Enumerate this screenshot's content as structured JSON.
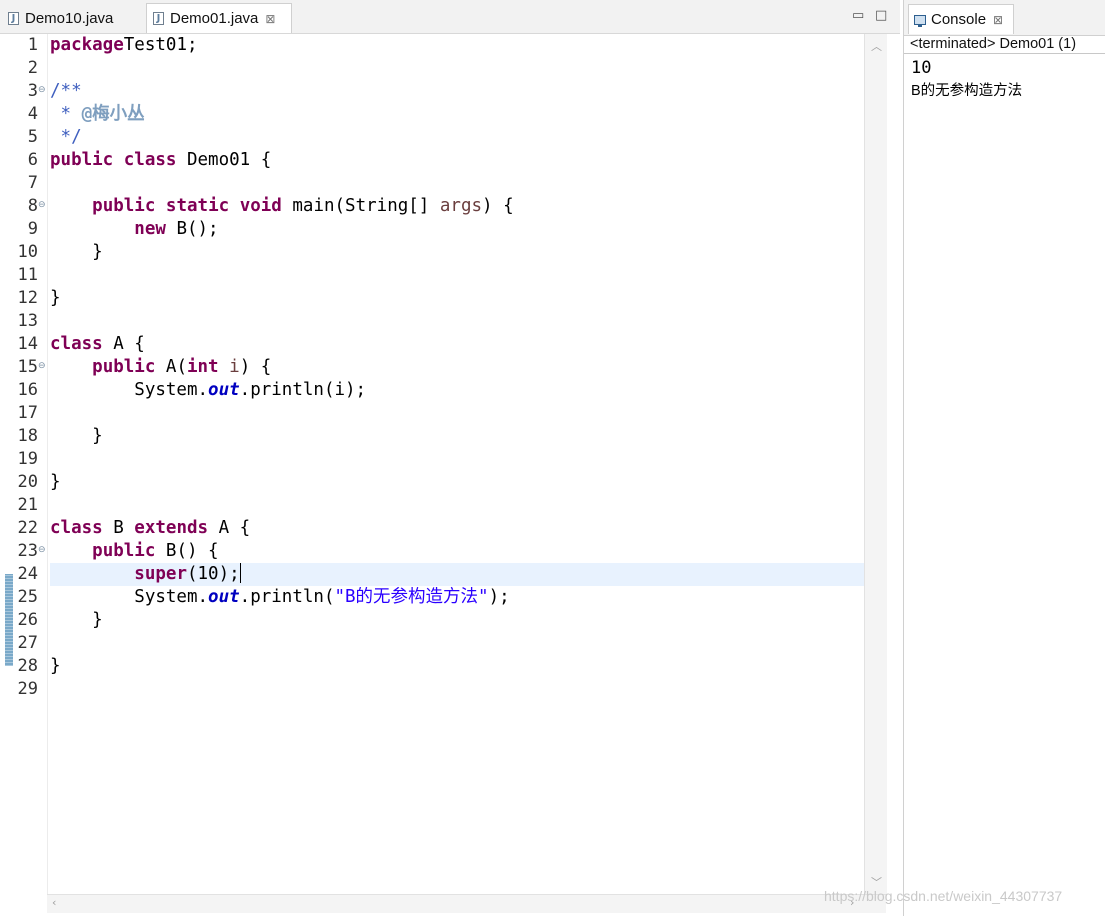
{
  "editor": {
    "tabs": [
      {
        "label": "Demo10.java",
        "active": false
      },
      {
        "label": "Demo01.java",
        "active": true
      }
    ],
    "close_glyph": "⊠",
    "minimize_glyph": "▭",
    "maximize_glyph": "□",
    "current_line": 24,
    "lines": [
      {
        "n": "1",
        "tokens": [
          [
            "kw",
            "package"
          ],
          [
            "",
            "Test01;"
          ]
        ]
      },
      {
        "n": "2",
        "tokens": []
      },
      {
        "n": "3",
        "fold": true,
        "tokens": [
          [
            "cm",
            "/**"
          ]
        ]
      },
      {
        "n": "4",
        "tokens": [
          [
            "cm",
            " * "
          ],
          [
            "cmtag",
            "@梅小丛"
          ]
        ]
      },
      {
        "n": "5",
        "tokens": [
          [
            "cm",
            " */"
          ]
        ]
      },
      {
        "n": "6",
        "tokens": [
          [
            "kw",
            "public"
          ],
          [
            "",
            " "
          ],
          [
            "kw",
            "class"
          ],
          [
            "",
            " Demo01 {"
          ]
        ]
      },
      {
        "n": "7",
        "tokens": []
      },
      {
        "n": "8",
        "fold": true,
        "tokens": [
          [
            "",
            "    "
          ],
          [
            "kw",
            "public"
          ],
          [
            "",
            " "
          ],
          [
            "kw",
            "static"
          ],
          [
            "",
            " "
          ],
          [
            "kw",
            "void"
          ],
          [
            "",
            " main(String[] "
          ],
          [
            "prm",
            "args"
          ],
          [
            "",
            ") {"
          ]
        ]
      },
      {
        "n": "9",
        "tokens": [
          [
            "",
            "        "
          ],
          [
            "kw",
            "new"
          ],
          [
            "",
            " B();"
          ]
        ]
      },
      {
        "n": "10",
        "tokens": [
          [
            "",
            "    }"
          ]
        ]
      },
      {
        "n": "11",
        "tokens": []
      },
      {
        "n": "12",
        "tokens": [
          [
            "",
            "}"
          ]
        ]
      },
      {
        "n": "13",
        "tokens": []
      },
      {
        "n": "14",
        "tokens": [
          [
            "kw",
            "class"
          ],
          [
            "",
            " A {"
          ]
        ]
      },
      {
        "n": "15",
        "fold": true,
        "tokens": [
          [
            "",
            "    "
          ],
          [
            "kw",
            "public"
          ],
          [
            "",
            " A("
          ],
          [
            "kw",
            "int"
          ],
          [
            "",
            " "
          ],
          [
            "prm",
            "i"
          ],
          [
            "",
            ") {"
          ]
        ]
      },
      {
        "n": "16",
        "tokens": [
          [
            "",
            "        System."
          ],
          [
            "fld",
            "out"
          ],
          [
            "",
            ".println(i);"
          ]
        ]
      },
      {
        "n": "17",
        "tokens": []
      },
      {
        "n": "18",
        "tokens": [
          [
            "",
            "    }"
          ]
        ]
      },
      {
        "n": "19",
        "tokens": []
      },
      {
        "n": "20",
        "tokens": [
          [
            "",
            "}"
          ]
        ]
      },
      {
        "n": "21",
        "tokens": []
      },
      {
        "n": "22",
        "tokens": [
          [
            "kw",
            "class"
          ],
          [
            "",
            " B "
          ],
          [
            "kw",
            "extends"
          ],
          [
            "",
            " A {"
          ]
        ]
      },
      {
        "n": "23",
        "fold": true,
        "tokens": [
          [
            "",
            "    "
          ],
          [
            "kw",
            "public"
          ],
          [
            "",
            " B() {"
          ]
        ]
      },
      {
        "n": "24",
        "tokens": [
          [
            "",
            "        "
          ],
          [
            "kw",
            "super"
          ],
          [
            "",
            "(10);"
          ]
        ],
        "caret": true
      },
      {
        "n": "25",
        "tokens": [
          [
            "",
            "        System."
          ],
          [
            "fld",
            "out"
          ],
          [
            "",
            ".println("
          ],
          [
            "str",
            "\"B的无参构造方法\""
          ],
          [
            "",
            ");"
          ]
        ]
      },
      {
        "n": "26",
        "tokens": [
          [
            "",
            "    }"
          ]
        ]
      },
      {
        "n": "27",
        "tokens": []
      },
      {
        "n": "28",
        "tokens": [
          [
            "",
            "}"
          ]
        ]
      },
      {
        "n": "29",
        "tokens": []
      }
    ]
  },
  "console": {
    "tab_label": "Console",
    "close_glyph": "⊠",
    "status": "<terminated> Demo01 (1)",
    "output": [
      "10",
      "B的无参构造方法"
    ]
  },
  "watermark": "https://blog.csdn.net/weixin_44307737",
  "colors": {
    "keyword": "#7f0055",
    "comment": "#3f5fbf",
    "javadoc_tag": "#7f9fbf",
    "field": "#0000c0",
    "string": "#2a00ff",
    "parameter": "#6a3e3e",
    "current_line": "#e8f2fe"
  }
}
